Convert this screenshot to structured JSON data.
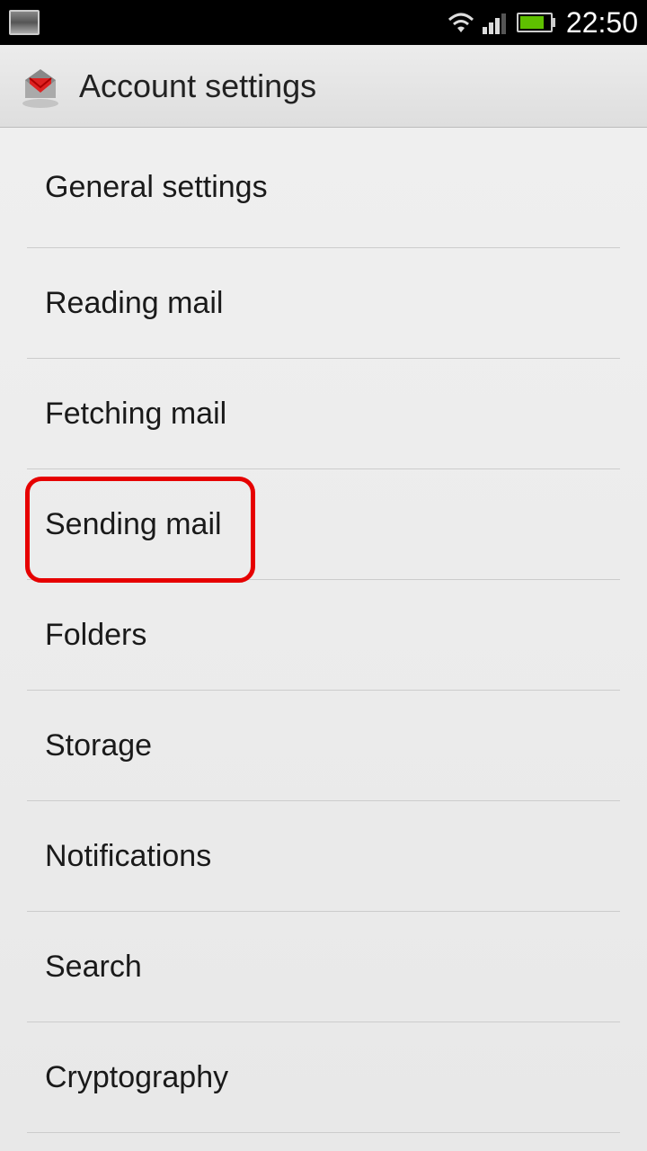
{
  "status": {
    "clock": "22:50"
  },
  "header": {
    "title": "Account settings"
  },
  "list": {
    "items": [
      {
        "label": "General settings"
      },
      {
        "label": "Reading mail"
      },
      {
        "label": "Fetching mail"
      },
      {
        "label": "Sending mail"
      },
      {
        "label": "Folders"
      },
      {
        "label": "Storage"
      },
      {
        "label": "Notifications"
      },
      {
        "label": "Search"
      },
      {
        "label": "Cryptography"
      }
    ]
  },
  "highlight": {
    "target_index": 3
  }
}
